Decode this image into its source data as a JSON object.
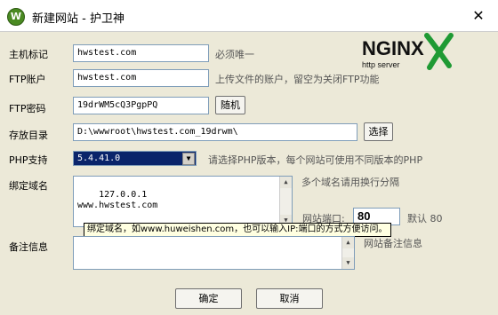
{
  "window": {
    "title": "新建网站 - 护卫神",
    "close_glyph": "✕",
    "icon_glyph": "W"
  },
  "form": {
    "host_label": "主机标记",
    "host_value": "hwstest.com",
    "host_hint": "必须唯一",
    "ftp_user_label": "FTP账户",
    "ftp_user_value": "hwstest.com",
    "ftp_user_hint": "上传文件的账户，留空为关闭FTP功能",
    "ftp_pass_label": "FTP密码",
    "ftp_pass_value": "19drWM5cQ3PgpPQ",
    "random_button": "随机",
    "dir_label": "存放目录",
    "dir_value": "D:\\wwwroot\\hwstest.com_19drwm\\",
    "choose_button": "选择",
    "php_label": "PHP支持",
    "php_value": "5.4.41.0",
    "php_hint": "请选择PHP版本，每个网站可使用不同版本的PHP",
    "domain_label": "绑定域名",
    "domain_value": "127.0.0.1\nwww.hwstest.com",
    "domain_hint": "多个域名请用换行分隔",
    "port_label": "网站端口:",
    "port_value": "80",
    "port_hint": "默认 80",
    "tooltip": "绑定域名，如www.huweishen.com，也可以输入IP:端口的方式方便访问。",
    "notes_label": "备注信息",
    "notes_value": "",
    "notes_hint": "网站备注信息"
  },
  "logo": {
    "brand": "NGINX",
    "tagline": "http server"
  },
  "footer": {
    "ok_button": "确定",
    "cancel_button": "取消"
  }
}
